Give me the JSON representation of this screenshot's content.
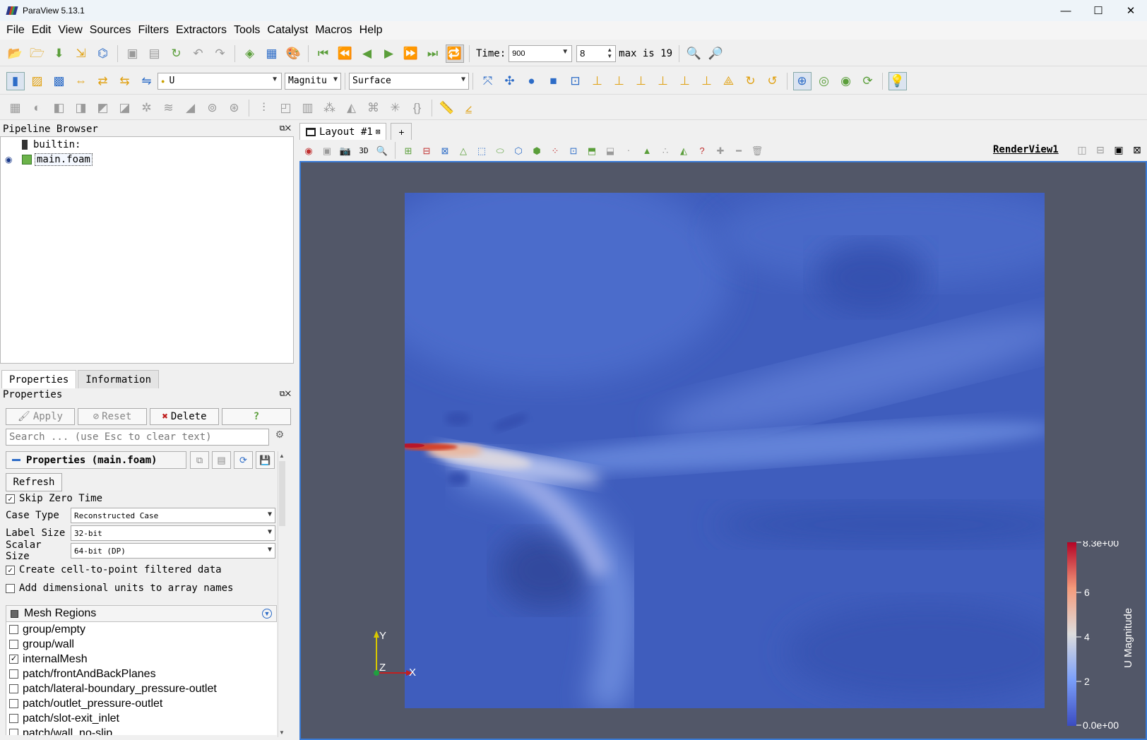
{
  "window": {
    "title": "ParaView 5.13.1",
    "min": "—",
    "max": "☐",
    "close": "✕"
  },
  "menu": [
    "File",
    "Edit",
    "View",
    "Sources",
    "Filters",
    "Extractors",
    "Tools",
    "Catalyst",
    "Macros",
    "Help"
  ],
  "time": {
    "label": "Time:",
    "value": "900",
    "index": "8",
    "max_text": "max is 19"
  },
  "toolbar2": {
    "array_combo": "U",
    "component_combo": "Magnitu",
    "repr_combo": "Surface"
  },
  "pipeline": {
    "header": "Pipeline Browser",
    "root": "builtin:",
    "source": "main.foam"
  },
  "tabs": {
    "properties": "Properties",
    "information": "Information"
  },
  "props": {
    "header": "Properties",
    "apply": "Apply",
    "reset": "Reset",
    "delete": "Delete",
    "help": "?",
    "search_placeholder": "Search ... (use Esc to clear text)",
    "section": "Properties (main.foam)",
    "refresh": "Refresh",
    "skip_zero_time": "Skip Zero Time",
    "case_type_label": "Case Type",
    "case_type_value": "Reconstructed Case",
    "label_size_label": "Label Size",
    "label_size_value": "32-bit",
    "scalar_size_label": "Scalar Size",
    "scalar_size_value": "64-bit (DP)",
    "cell_to_point": "Create cell-to-point filtered data",
    "dim_units": "Add dimensional units to array names",
    "mesh_regions": "Mesh Regions",
    "mesh_items": [
      {
        "name": "group/empty",
        "checked": false
      },
      {
        "name": "group/wall",
        "checked": false
      },
      {
        "name": "internalMesh",
        "checked": true
      },
      {
        "name": "patch/frontAndBackPlanes",
        "checked": false
      },
      {
        "name": "patch/lateral-boundary_pressure-outlet",
        "checked": false
      },
      {
        "name": "patch/outlet_pressure-outlet",
        "checked": false
      },
      {
        "name": "patch/slot-exit_inlet",
        "checked": false
      },
      {
        "name": "patch/wall_no-slip",
        "checked": false
      }
    ]
  },
  "layout": {
    "tab": "Layout #1",
    "plus": "+",
    "view_name": "RenderView1",
    "3d": "3D"
  },
  "axes": {
    "x": "X",
    "y": "Y",
    "z": "Z"
  },
  "colorbar": {
    "title": "U Magnitude",
    "max": "8.3e+00",
    "t6": "6",
    "t4": "4",
    "t2": "2",
    "min": "0.0e+00",
    "colors": {
      "low": "#3b4cc0",
      "mid": "#dddddd",
      "high": "#b40426"
    }
  }
}
